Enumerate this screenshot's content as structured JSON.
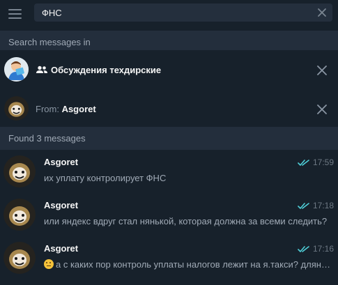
{
  "search": {
    "value": "ФНС"
  },
  "search_section": {
    "label": "Search messages in"
  },
  "chat_filter": {
    "name": "Обсуждения техдирские"
  },
  "from_filter": {
    "label": "From: ",
    "name": "Asgoret"
  },
  "results": {
    "label": "Found 3 messages"
  },
  "messages": [
    {
      "sender": "Asgoret",
      "time": "17:59",
      "text": "их уплату контролирует ФНС"
    },
    {
      "sender": "Asgoret",
      "time": "17:18",
      "text": "или яндекс вдруг стал нянькой, которая должна за всеми следить?"
    },
    {
      "sender": "Asgoret",
      "time": "17:16",
      "text": "а с каких пор контроль уплаты налогов лежит на я.такси? длянуйте"
    }
  ],
  "colors": {
    "background": "#17212b",
    "header_bg": "#232e3c",
    "read_check": "#4fcfd8",
    "muted_text": "#a0aab6"
  },
  "icons": [
    "hamburger-menu-icon",
    "clear-search-icon",
    "group-icon",
    "close-icon",
    "double-check-icon",
    "thinking-emoji-icon"
  ]
}
